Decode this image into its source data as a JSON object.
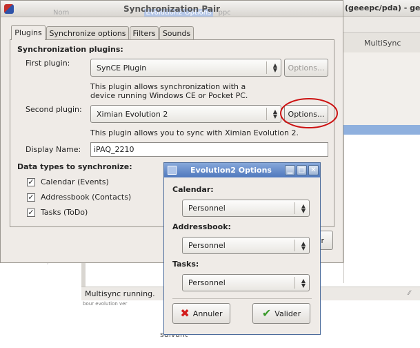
{
  "background": {
    "top_right_title": "(geeepc/pda) - gedit",
    "tab_multisync": "MultiSync",
    "status_text": "Multisync running.",
    "bottom_text": "suivant",
    "faint_header_text": "Nom",
    "faint_header_text2": "Evolution2 Options",
    "faint_header_text3": "ppc"
  },
  "sync_pair": {
    "title": "Synchronization Pair",
    "tabs": [
      "Plugins",
      "Synchronize options",
      "Filters",
      "Sounds"
    ],
    "active_tab": "Plugins",
    "plugins_section_title": "Synchronization plugins:",
    "first_plugin_label": "First plugin:",
    "first_plugin_value": "SynCE Plugin",
    "options_label": "Options...",
    "first_plugin_desc": "This plugin allows synchronization with a device running Windows CE or Pocket PC.",
    "second_plugin_label": "Second plugin:",
    "second_plugin_value": "Ximian Evolution 2",
    "second_plugin_desc": "This plugin allows you to sync with Ximian Evolution 2.",
    "display_name_label": "Display Name:",
    "display_name_value": "iPAQ_2210",
    "data_types_title": "Data types to synchronize:",
    "data_types": [
      {
        "label": "Calendar (Events)",
        "checked": true
      },
      {
        "label": "Addressbook (Contacts)",
        "checked": true
      },
      {
        "label": "Tasks (ToDo)",
        "checked": true
      }
    ],
    "partial_button_text": "r"
  },
  "evo_dialog": {
    "title": "Evolution2 Options",
    "calendar_label": "Calendar:",
    "calendar_value": "Personnel",
    "addressbook_label": "Addressbook:",
    "addressbook_value": "Personnel",
    "tasks_label": "Tasks:",
    "tasks_value": "Personnel",
    "cancel_label": "Annuler",
    "ok_label": "Valider"
  },
  "colors": {
    "titlebar_blue": "#5a82c8",
    "dialog_bg": "#efebe7",
    "highlight_circle": "#cc1111",
    "panel_blue": "#8fb0de"
  }
}
